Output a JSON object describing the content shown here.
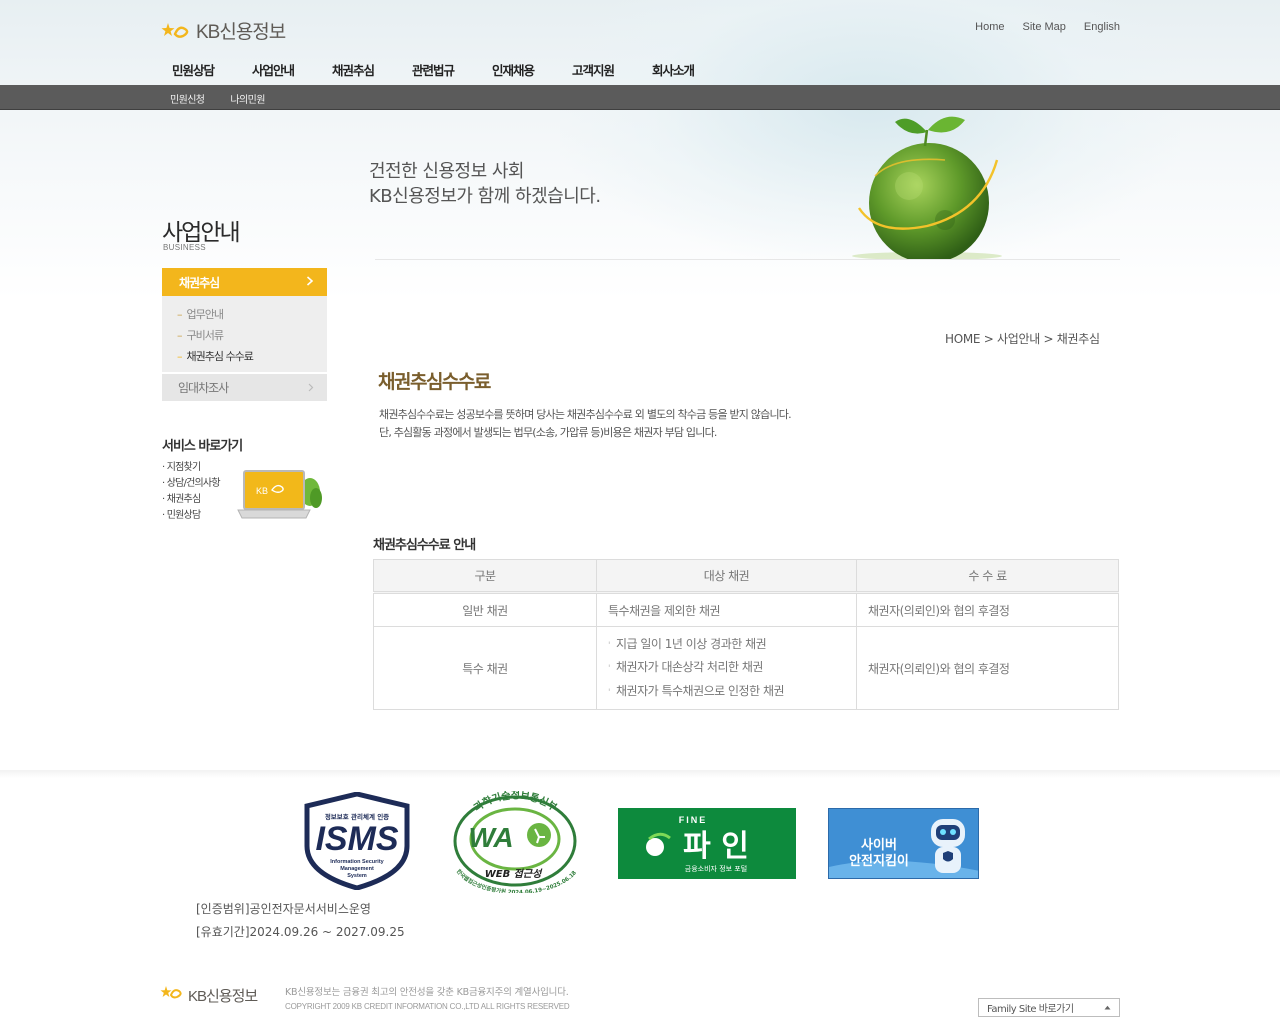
{
  "header": {
    "logo_text": "KB신용정보",
    "utility": [
      "Home",
      "Site Map",
      "English"
    ],
    "gnb": [
      "민원상담",
      "사업안내",
      "채권추심",
      "관련법규",
      "인재채용",
      "고객지원",
      "회사소개"
    ],
    "subnav": [
      "민원신청",
      "나의민원"
    ]
  },
  "hero": {
    "line1": "건전한 신용정보 사회",
    "line2": "KB신용정보가 함께 하겠습니다."
  },
  "sidebar": {
    "section_title": "사업안내",
    "section_sub": "BUSINESS",
    "active_item": "채권추심",
    "sub_items": [
      {
        "label": "업무안내",
        "active": false
      },
      {
        "label": "구비서류",
        "active": false
      },
      {
        "label": "채권추심 수수료",
        "active": true
      }
    ],
    "other_item": "임대차조사",
    "service_title": "서비스 바로가기",
    "service_links": [
      "· 지점찾기",
      "· 상담/건의사항",
      "· 채권추심",
      "· 민원상담"
    ],
    "banner_text": "KB"
  },
  "breadcrumb": "HOME > 사업안내 > 채권추심",
  "page_title": "채권추심수수료",
  "description": {
    "line1": "채권추심수수료는 성공보수를 뜻하며 당사는 채권추심수수료 외 별도의 착수금 등을 받지 않습니다.",
    "line2": "단, 추심활동 과정에서 발생되는 법무(소송, 가압류 등)비용은 채권자 부담 입니다."
  },
  "table": {
    "title": "채권추심수수료 안내",
    "headers": [
      "구분",
      "대상 채권",
      "수 수 료"
    ],
    "rows": [
      {
        "type": "일반 채권",
        "target": [
          "특수채권을 제외한 채권"
        ],
        "fee": "채권자(의뢰인)와 협의 후결정"
      },
      {
        "type": "특수 채권",
        "target": [
          "지급 일이 1년 이상 경과한 채권",
          "채권자가 대손상각 처리한 채권",
          "채권자가 특수채권으로 인정한 채권"
        ],
        "fee": "채권자(의뢰인)와 협의 후결정"
      }
    ]
  },
  "footer": {
    "isms": {
      "top": "정보보호 관리체계 인증",
      "main": "ISMS",
      "sub1": "Information Security",
      "sub2": "Management",
      "sub3": "System"
    },
    "wa": {
      "arc_top": "과학기술정보통신부",
      "main": "WA",
      "web": "WEB 접근성",
      "arc_bottom": "한국웹접근성인증평가원 2024.06.19~2025.06.18"
    },
    "fine": {
      "top": "FINE",
      "main": "파 인",
      "sub": "금융소비자 정보 포털"
    },
    "cyber": {
      "line1": "사이버",
      "line2": "안전지킴이"
    },
    "cert_scope": "[인증범위]공인전자문서서비스운영",
    "cert_period": "[유효기간]2024.09.26 ~ 2027.09.25",
    "logo_text": "KB신용정보",
    "copy1": "KB신용정보는 금융권 최고의 안전성을 갖춘 KB금융지주의 계열사입니다.",
    "copy2": "COPYRIGHT 2009 KB CREDIT INFORMATION CO.,LTD  ALL RIGHTS RESERVED",
    "family_site": "Family Site 바로가기"
  },
  "colors": {
    "accent": "#f3b61c",
    "subnav_bg": "#5b5b5b",
    "title_brown": "#7a5e2d",
    "fine_green": "#0d8a3d",
    "cyber_blue": "#3f8fd4"
  }
}
